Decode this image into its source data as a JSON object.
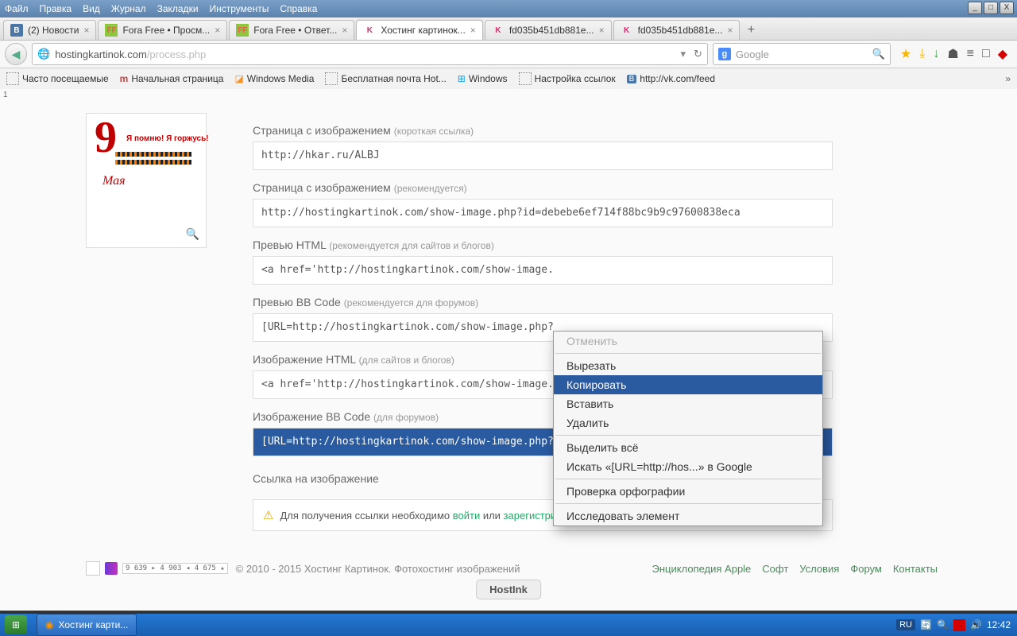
{
  "menu": {
    "items": [
      "Файл",
      "Правка",
      "Вид",
      "Журнал",
      "Закладки",
      "Инструменты",
      "Справка"
    ]
  },
  "window_controls": {
    "min": "_",
    "max": "□",
    "close": "X"
  },
  "tabs": [
    {
      "icon": "В",
      "icon_bg": "#4a76a8",
      "icon_fg": "#fff",
      "label": "(2) Новости",
      "active": false
    },
    {
      "icon": "FF",
      "icon_bg": "#8dc63f",
      "icon_fg": "#d64",
      "label": "Fora Free • Просм...",
      "active": false
    },
    {
      "icon": "FF",
      "icon_bg": "#8dc63f",
      "icon_fg": "#d64",
      "label": "Fora Free • Ответ...",
      "active": false
    },
    {
      "icon": "K",
      "icon_bg": "transparent",
      "icon_fg": "#d02f6e",
      "label": "Хостинг картинок...",
      "active": true
    },
    {
      "icon": "K",
      "icon_bg": "transparent",
      "icon_fg": "#d02f6e",
      "label": "fd035b451db881e...",
      "active": false
    },
    {
      "icon": "K",
      "icon_bg": "transparent",
      "icon_fg": "#d02f6e",
      "label": "fd035b451db881e...",
      "active": false
    }
  ],
  "url": {
    "host": "hostingkartinok.com",
    "path": "/process.php"
  },
  "search": {
    "placeholder": "Google"
  },
  "toolbar_icons": [
    "★",
    "⤓",
    "↓",
    "☗",
    "≡",
    "□",
    "◆"
  ],
  "bookmarks": [
    "Часто посещаемые",
    "Начальная страница",
    "Windows Media",
    "Бесплатная почта Hot...",
    "Windows",
    "Настройка ссылок",
    "http://vk.com/feed"
  ],
  "thumb": {
    "nine": "9",
    "maya": "Мая",
    "text": "Я помню! Я горжусь!"
  },
  "fields": [
    {
      "label": "Страница с изображением",
      "hint": "(короткая ссылка)",
      "value": "http://hkar.ru/ALBJ"
    },
    {
      "label": "Страница с изображением",
      "hint": "(рекомендуется)",
      "value": "http://hostingkartinok.com/show-image.php?id=debebe6ef714f88bc9b9c97600838eca"
    },
    {
      "label": "Превью HTML",
      "hint": "(рекомендуется для сайтов и блогов)",
      "value": "<a href='http://hostingkartinok.com/show-image."
    },
    {
      "label": "Превью BB Code",
      "hint": "(рекомендуется для форумов)",
      "value": "[URL=http://hostingkartinok.com/show-image.php?"
    },
    {
      "label": "Изображение HTML",
      "hint": "(для сайтов и блогов)",
      "value": "<a href='http://hostingkartinok.com/show-image."
    },
    {
      "label": "Изображение BB Code",
      "hint": "(для форумов)",
      "value": "[URL=http://hostingkartinok.com/show-image.php?id=debebe6ef714f88bc9b9c97600838eca][IMG]ht",
      "selected": true
    }
  ],
  "link_section": {
    "label": "Ссылка на изображение",
    "text_pre": "Для получения ссылки необходимо ",
    "login": "войти",
    "or": " или ",
    "register": "зарегистрироваться",
    "dot": "."
  },
  "footer": {
    "stats": "9 639 ▸\n4 903 ◂\n4 675 ▴",
    "copy": "© 2010 - 2015 Хостинг Картинок. Фотохостинг изображений",
    "links": [
      "Энциклопедия Apple",
      "Софт",
      "Условия",
      "Форум",
      "Контакты"
    ],
    "hostink": "HostInk"
  },
  "context": {
    "items": [
      {
        "label": "Отменить",
        "disabled": true
      },
      {
        "sep": true
      },
      {
        "label": "Вырезать"
      },
      {
        "label": "Копировать",
        "hover": true
      },
      {
        "label": "Вставить"
      },
      {
        "label": "Удалить"
      },
      {
        "sep": true
      },
      {
        "label": "Выделить всё"
      },
      {
        "label": "Искать «[URL=http://hos...» в Google"
      },
      {
        "sep": true
      },
      {
        "label": "Проверка орфографии"
      },
      {
        "sep": true
      },
      {
        "label": "Исследовать элемент"
      }
    ]
  },
  "taskbar": {
    "title": "Хостинг карти...",
    "lang": "RU",
    "clock": "12:42"
  }
}
